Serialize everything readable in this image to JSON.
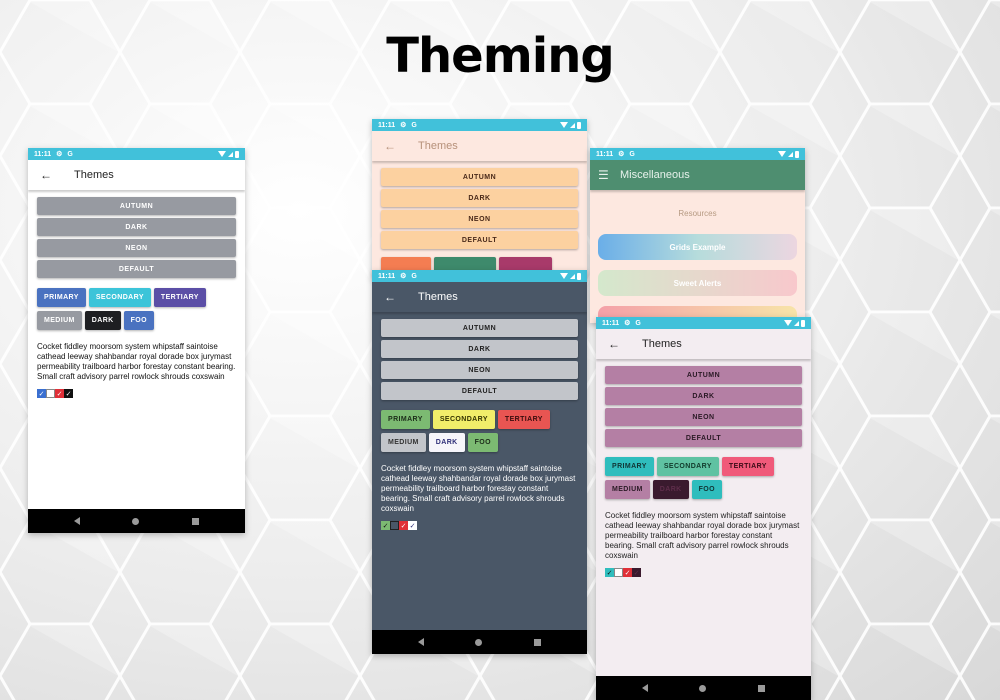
{
  "page_title": "Theming",
  "status_bar": {
    "time": "11:11",
    "gear": "⚙",
    "google": "G"
  },
  "themes_screen": {
    "title": "Themes",
    "back_icon": "←",
    "theme_buttons": [
      "AUTUMN",
      "DARK",
      "NEON",
      "DEFAULT"
    ],
    "chips_row1": [
      "PRIMARY",
      "SECONDARY",
      "TERTIARY"
    ],
    "chips_row2": [
      "MEDIUM",
      "DARK",
      "FOO"
    ],
    "paragraph": "Cocket fiddley moorsom system whipstaff saintoise cathead leeway shahbandar royal dorade box jurymast permeability trailboard harbor forestay constant bearing. Small craft advisory parrel rowlock shrouds coxswain",
    "check_glyph": "✓"
  },
  "misc_screen": {
    "title": "Miscellaneous",
    "menu_icon": "☰",
    "section_label": "Resources",
    "buttons": [
      "Grids Example",
      "Sweet Alerts"
    ]
  },
  "themes": {
    "default": {
      "bg": "#ffffff",
      "appbar_bg": "#ffffff",
      "appbar_fg": "#222222",
      "btn_bg": "#979aa1",
      "btn_fg": "#ffffff",
      "chip_colors": [
        "#4a72c0",
        "#3cc4d9",
        "#5b4ea6",
        "#979aa1",
        "#1e1f22",
        "#4a72c0"
      ],
      "chip_fg": [
        "#ffffff",
        "#ffffff",
        "#ffffff",
        "#ffffff",
        "#ffffff",
        "#ffffff"
      ],
      "text": "#111111",
      "checks": [
        "#3a6fd0",
        "#ffffff",
        "#e03038",
        "#111111"
      ]
    },
    "autumn": {
      "bg": "#fde8e0",
      "appbar_bg": "#fde8e0",
      "appbar_fg": "#b6917a",
      "btn_bg": "#fcd1a0",
      "btn_fg": "#4a2a1a",
      "chip_colors": [
        "#f47d52",
        "#3e8a6c",
        "#a83a6a"
      ]
    },
    "dark": {
      "bg": "#4a5767",
      "appbar_bg": "#4a5767",
      "appbar_fg": "#ffffff",
      "btn_bg": "#c2c5ca",
      "btn_fg": "#222222",
      "chip_colors": [
        "#7cba72",
        "#f1ed6a",
        "#e85552",
        "#c2c5ca",
        "#f6f5fa",
        "#7cba72"
      ],
      "chip_fg": [
        "#1d2d1a",
        "#333300",
        "#3a0d0d",
        "#333333",
        "#2e2e78",
        "#1d2d1a"
      ],
      "text": "#ffffff",
      "checks": [
        "#7cba72",
        "#4a5767",
        "#e03038",
        "#ffffff"
      ]
    },
    "neon": {
      "bg": "#f3edf1",
      "appbar_bg": "#f3edf1",
      "appbar_fg": "#222222",
      "btn_bg": "#b47fa4",
      "btn_fg": "#2b1a26",
      "chip_colors": [
        "#2fbdbd",
        "#5fc2a2",
        "#f05a7a",
        "#b47fa4",
        "#3a1a2e",
        "#2fbdbd"
      ],
      "chip_fg": [
        "#113535",
        "#113a2b",
        "#3a0a16",
        "#2b1a26",
        "#5e2d4a",
        "#113535"
      ],
      "text": "#222222",
      "checks": [
        "#2fbdbd",
        "#ffffff",
        "#e03038",
        "#3a1a2e"
      ]
    },
    "misc": {
      "bg": "#fde8e0",
      "appbar_bg": "#4e8e70",
      "appbar_fg": "#e8f2ec",
      "label": "#b69a82"
    }
  }
}
